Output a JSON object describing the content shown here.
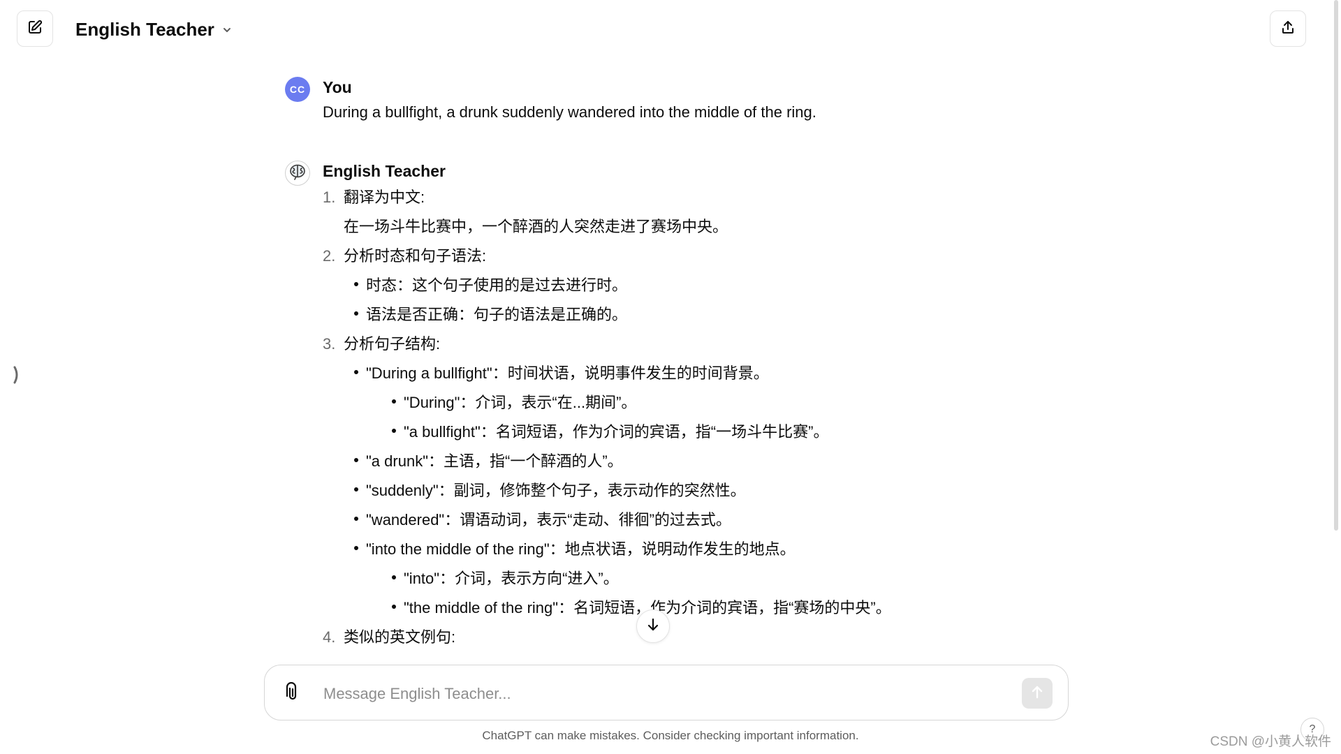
{
  "header": {
    "title": "English Teacher",
    "icons": {
      "new_chat": "pencil-square-icon",
      "dropdown": "chevron-down-icon",
      "share": "upload-icon",
      "sidebar": "chevron-right-icon"
    }
  },
  "messages": {
    "user": {
      "avatar": "CC",
      "author": "You",
      "text": "During a bullfight, a drunk suddenly wandered into the middle of the ring."
    },
    "bot": {
      "author": "English Teacher",
      "avatar_icon": "brain-icon",
      "items": [
        {
          "num": "1.",
          "label": "翻译为中文:"
        },
        {
          "text": "在一场斗牛比赛中，一个醉酒的人突然走进了赛场中央。"
        },
        {
          "num": "2.",
          "label": "分析时态和句子语法:"
        },
        {
          "b1": "时态：这个句子使用的是过去进行时。"
        },
        {
          "b2": "语法是否正确：句子的语法是正确的。"
        },
        {
          "num": "3.",
          "label": "分析句子结构:"
        },
        {
          "b3": "\"During a bullfight\"：时间状语，说明事件发生的时间背景。"
        },
        {
          "b4": "\"During\"：介词，表示“在...期间”。"
        },
        {
          "b5": "\"a bullfight\"：名词短语，作为介词的宾语，指“一场斗牛比赛”。"
        },
        {
          "b6": "\"a drunk\"：主语，指“一个醉酒的人”。"
        },
        {
          "b7": "\"suddenly\"：副词，修饰整个句子，表示动作的突然性。"
        },
        {
          "b8": "\"wandered\"：谓语动词，表示“走动、徘徊”的过去式。"
        },
        {
          "b9": "\"into the middle of the ring\"：地点状语，说明动作发生的地点。"
        },
        {
          "b10": "\"into\"：介词，表示方向“进入”。"
        },
        {
          "b11": "\"the middle of the ring\"：名词短语，作为介词的宾语，指“赛场的中央”。"
        },
        {
          "num": "4.",
          "label": "类似的英文例句:"
        }
      ]
    }
  },
  "composer": {
    "placeholder": "Message English Teacher...",
    "icons": {
      "attach": "paperclip-icon",
      "send": "arrow-up-icon",
      "scroll_down": "arrow-down-icon"
    }
  },
  "footer": {
    "disclaimer": "ChatGPT can make mistakes. Consider checking important information.",
    "help": "?",
    "watermark": "CSDN @小黄人软件"
  }
}
